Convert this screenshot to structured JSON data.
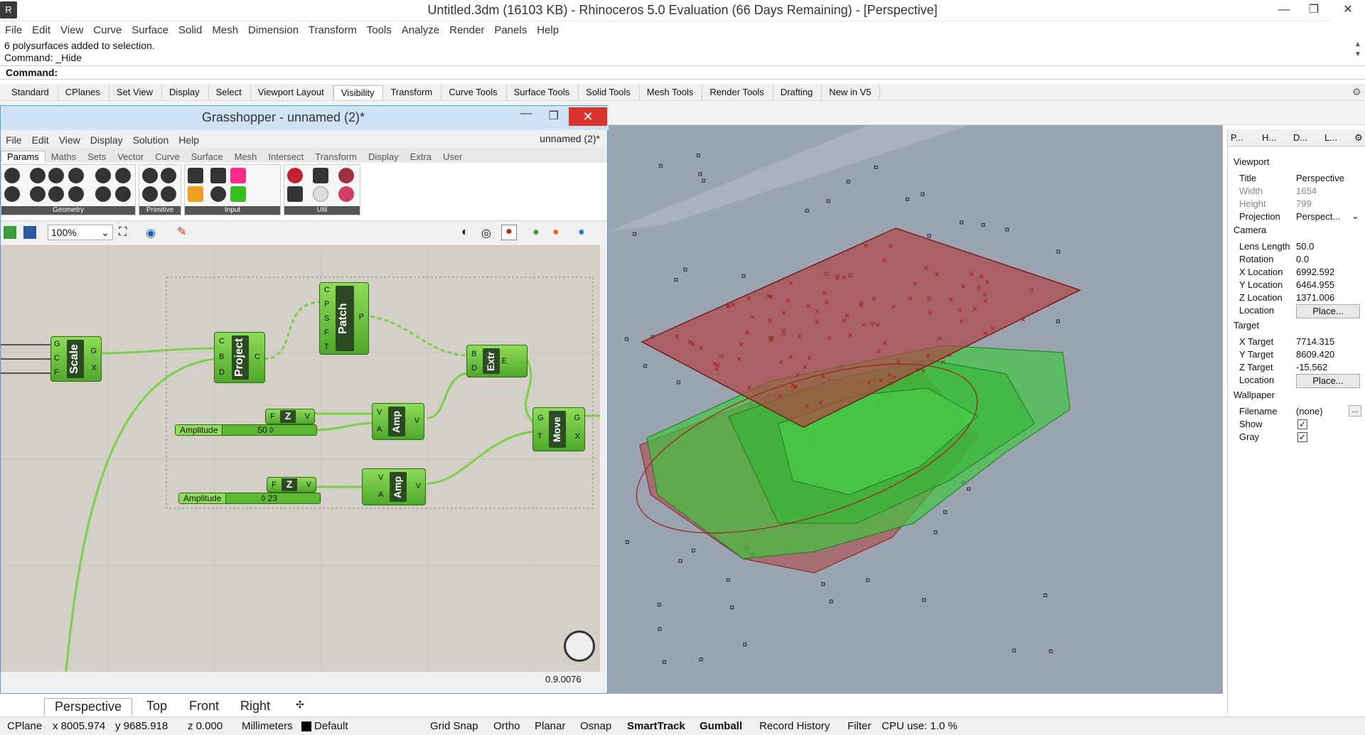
{
  "window": {
    "title": "Untitled.3dm (16103 KB) - Rhinoceros 5.0 Evaluation (66 Days Remaining) - [Perspective]"
  },
  "menu": [
    "File",
    "Edit",
    "View",
    "Curve",
    "Surface",
    "Solid",
    "Mesh",
    "Dimension",
    "Transform",
    "Tools",
    "Analyze",
    "Render",
    "Panels",
    "Help"
  ],
  "command": {
    "history": [
      "6 polysurfaces added to selection.",
      "Command: _Hide"
    ],
    "prompt": "Command:"
  },
  "toolbar_tabs": [
    "Standard",
    "CPlanes",
    "Set View",
    "Display",
    "Select",
    "Viewport Layout",
    "Visibility",
    "Transform",
    "Curve Tools",
    "Surface Tools",
    "Solid Tools",
    "Mesh Tools",
    "Render Tools",
    "Drafting",
    "New in V5"
  ],
  "active_toolbar_tab": "Visibility",
  "grasshopper": {
    "title": "Grasshopper - unnamed (2)*",
    "doc_name": "unnamed (2)*",
    "menu": [
      "File",
      "Edit",
      "View",
      "Display",
      "Solution",
      "Help"
    ],
    "tabs": [
      "Params",
      "Maths",
      "Sets",
      "Vector",
      "Curve",
      "Surface",
      "Mesh",
      "Intersect",
      "Transform",
      "Display",
      "Extra",
      "User"
    ],
    "active_tab": "Params",
    "groups": [
      "Geometry",
      "Primitive",
      "Input",
      "Util"
    ],
    "zoom": "100%",
    "version": "0.9.0076",
    "components": {
      "scale": {
        "name": "Scale",
        "in": [
          "G",
          "C",
          "F"
        ],
        "out": [
          "G",
          "X"
        ]
      },
      "project": {
        "name": "Project",
        "in": [
          "C",
          "B",
          "D"
        ],
        "out": [
          "C"
        ]
      },
      "patch": {
        "name": "Patch",
        "in": [
          "C",
          "P",
          "S",
          "F",
          "T"
        ],
        "out": [
          "P"
        ]
      },
      "extr": {
        "name": "Extr",
        "in": [
          "B",
          "D"
        ],
        "out": [
          "E"
        ]
      },
      "amp1": {
        "name": "Amp",
        "in": [
          "V",
          "A"
        ],
        "out": [
          "V"
        ]
      },
      "amp2": {
        "name": "Amp",
        "in": [
          "V",
          "A"
        ],
        "out": [
          "V"
        ]
      },
      "move": {
        "name": "Move",
        "in": [
          "G",
          "T"
        ],
        "out": [
          "G",
          "X"
        ]
      },
      "unitz1": {
        "in": "F",
        "name": "Z",
        "out": "V"
      },
      "unitz2": {
        "in": "F",
        "name": "Z",
        "out": "V"
      }
    },
    "sliders": [
      {
        "label": "Amplitude",
        "value": "50 ◊"
      },
      {
        "label": "Amplitude",
        "value": "◊ 23"
      }
    ]
  },
  "properties": {
    "tabs": [
      "P...",
      "H...",
      "D...",
      "L..."
    ],
    "viewport": {
      "section": "Viewport",
      "title_k": "Title",
      "title": "Perspective",
      "width_k": "Width",
      "width": "1654",
      "height_k": "Height",
      "height": "799",
      "projection_k": "Projection",
      "projection": "Perspect..."
    },
    "camera": {
      "section": "Camera",
      "lens_k": "Lens Length",
      "lens": "50.0",
      "rot_k": "Rotation",
      "rot": "0.0",
      "x_k": "X Location",
      "x": "6992.592",
      "y_k": "Y Location",
      "y": "6464.955",
      "z_k": "Z Location",
      "z": "1371.006",
      "loc_k": "Location",
      "place": "Place..."
    },
    "target": {
      "section": "Target",
      "x_k": "X Target",
      "x": "7714.315",
      "y_k": "Y Target",
      "y": "8609.420",
      "z_k": "Z Target",
      "z": "-15.562",
      "loc_k": "Location",
      "place": "Place..."
    },
    "wallpaper": {
      "section": "Wallpaper",
      "file_k": "Filename",
      "file": "(none)",
      "show_k": "Show",
      "gray_k": "Gray",
      "browse": "..."
    }
  },
  "viewport_tabs": [
    "Perspective",
    "Top",
    "Front",
    "Right"
  ],
  "active_viewport_tab": "Perspective",
  "status": {
    "cplane": "CPlane",
    "x": "x 8005.974",
    "y": "y 9685.918",
    "z": "z 0.000",
    "units": "Millimeters",
    "layer": "Default",
    "grid_snap": "Grid Snap",
    "ortho": "Ortho",
    "planar": "Planar",
    "osnap": "Osnap",
    "smarttrack": "SmartTrack",
    "gumball": "Gumball",
    "record": "Record History",
    "filter": "Filter",
    "cpu": "CPU use: 1.0 %"
  },
  "colors": {
    "gh_green": "#5fb833",
    "viewport_bg": "#9aa5b1",
    "surface_red": "#b04040",
    "solid_green": "#3ac73a"
  }
}
